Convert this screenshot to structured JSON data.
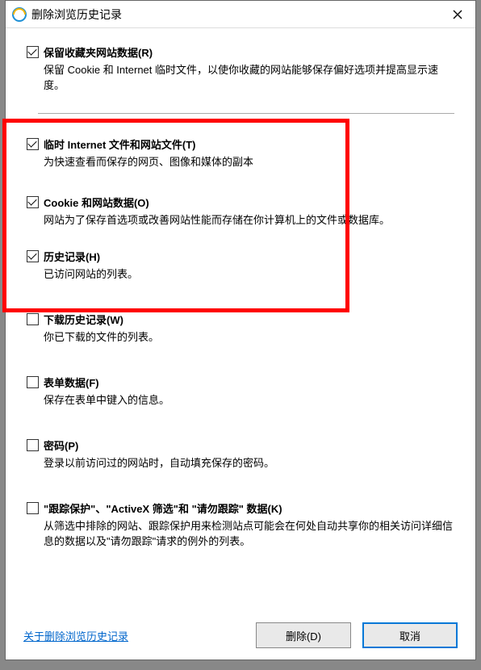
{
  "title": "删除浏览历史记录",
  "options": {
    "preserve": {
      "label": "保留收藏夹网站数据(R)",
      "desc": "保留 Cookie 和 Internet 临时文件，以使你收藏的网站能够保存偏好选项并提高显示速度。"
    },
    "temp": {
      "label": "临时 Internet 文件和网站文件(T)",
      "desc": "为快速查看而保存的网页、图像和媒体的副本"
    },
    "cookies": {
      "label": "Cookie 和网站数据(O)",
      "desc": "网站为了保存首选项或改善网站性能而存储在你计算机上的文件或数据库。"
    },
    "history": {
      "label": "历史记录(H)",
      "desc": "已访问网站的列表。"
    },
    "download": {
      "label": "下载历史记录(W)",
      "desc": "你已下载的文件的列表。"
    },
    "form": {
      "label": "表单数据(F)",
      "desc": "保存在表单中键入的信息。"
    },
    "password": {
      "label": "密码(P)",
      "desc": "登录以前访问过的网站时，自动填充保存的密码。"
    },
    "tracking": {
      "label": "\"跟踪保护\"、\"ActiveX 筛选\"和 \"请勿跟踪\" 数据(K)",
      "desc": "从筛选中排除的网站、跟踪保护用来检测站点可能会在何处自动共享你的相关访问详细信息的数据以及\"请勿跟踪\"请求的例外的列表。"
    }
  },
  "link": "关于删除浏览历史记录",
  "buttons": {
    "delete": "删除(D)",
    "cancel": "取消"
  }
}
